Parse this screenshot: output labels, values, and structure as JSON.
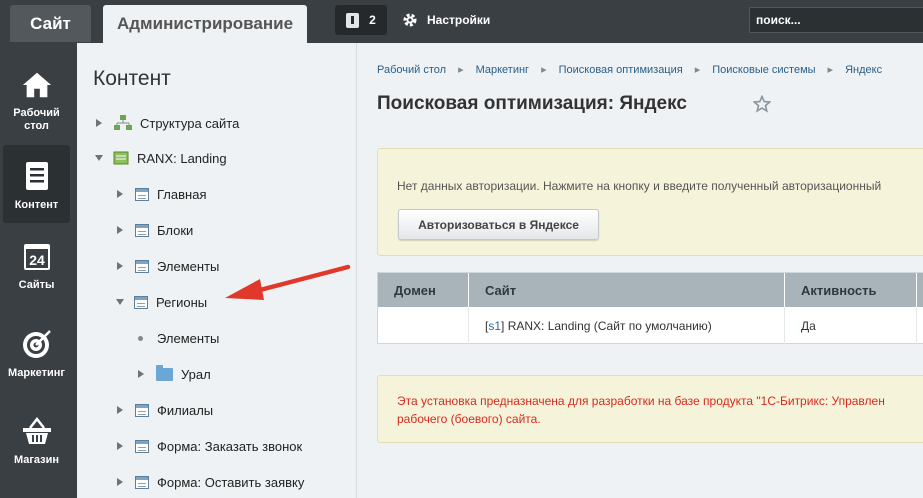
{
  "topbar": {
    "tab_site": "Сайт",
    "tab_admin": "Администрирование",
    "notifications_count": "2",
    "settings_label": "Настройки",
    "search_placeholder": "поиск..."
  },
  "nav": [
    {
      "label": "Рабочий стол",
      "icon": "home-icon",
      "active": false
    },
    {
      "label": "Контент",
      "icon": "document-icon",
      "active": true
    },
    {
      "label": "Сайты",
      "icon": "calendar-icon",
      "active": false
    },
    {
      "label": "Маркетинг",
      "icon": "target-icon",
      "active": false
    },
    {
      "label": "Магазин",
      "icon": "basket-icon",
      "active": false
    }
  ],
  "tree": {
    "title": "Контент",
    "items": [
      {
        "label": "Структура сайта",
        "state": "collapsed",
        "icon": "structure-icon"
      },
      {
        "label": "RANX: Landing",
        "state": "expanded",
        "icon": "site-icon"
      },
      {
        "label": "Главная",
        "state": "collapsed",
        "icon": "page-icon"
      },
      {
        "label": "Блоки",
        "state": "collapsed",
        "icon": "page-icon"
      },
      {
        "label": "Элементы",
        "state": "collapsed",
        "icon": "page-icon"
      },
      {
        "label": "Регионы",
        "state": "expanded",
        "icon": "page-icon"
      },
      {
        "label": "Элементы",
        "state": "leaf",
        "icon": "none"
      },
      {
        "label": "Урал",
        "state": "collapsed",
        "icon": "folder-icon"
      },
      {
        "label": "Филиалы",
        "state": "collapsed",
        "icon": "page-icon"
      },
      {
        "label": "Форма: Заказать звонок",
        "state": "collapsed",
        "icon": "page-icon"
      },
      {
        "label": "Форма: Оставить заявку",
        "state": "collapsed",
        "icon": "page-icon"
      }
    ]
  },
  "breadcrumbs": [
    "Рабочий стол",
    "Маркетинг",
    "Поисковая оптимизация",
    "Поисковые системы",
    "Яндекс"
  ],
  "page_title": "Поисковая оптимизация: Яндекс",
  "auth": {
    "message": "Нет данных авторизации. Нажмите на кнопку и введите полученный авторизационный",
    "button": "Авторизоваться в Яндексе"
  },
  "table": {
    "headers": [
      "Домен",
      "Сайт",
      "Активность"
    ],
    "row": {
      "domain": "",
      "site_code": "s1",
      "site_name": "RANX: Landing (Сайт по умолчанию)",
      "active": "Да"
    }
  },
  "warning": {
    "line1": "Эта установка предназначена для разработки на базе продукта \"1С-Битрикс: Управлен",
    "line2": "рабочего (боевого) сайта."
  },
  "colors": {
    "topbar": "#3a3f43",
    "accent_red": "#d52b1e",
    "link": "#2b5f88"
  }
}
